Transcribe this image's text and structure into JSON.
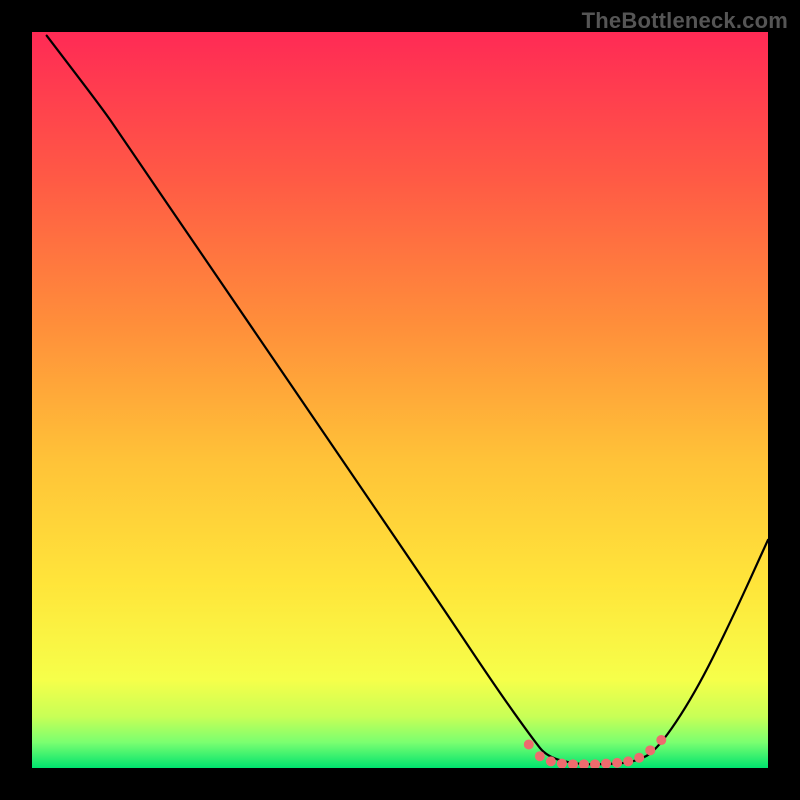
{
  "watermark": "TheBottleneck.com",
  "chart_data": {
    "type": "line",
    "title": "",
    "xlabel": "",
    "ylabel": "",
    "xlim": [
      0,
      100
    ],
    "ylim": [
      0,
      100
    ],
    "grid": false,
    "legend": false,
    "background_gradient": {
      "stops": [
        {
          "offset": 0.0,
          "color": "#ff2a55"
        },
        {
          "offset": 0.2,
          "color": "#ff5a45"
        },
        {
          "offset": 0.4,
          "color": "#ff8f3a"
        },
        {
          "offset": 0.58,
          "color": "#ffc238"
        },
        {
          "offset": 0.75,
          "color": "#ffe53a"
        },
        {
          "offset": 0.88,
          "color": "#f6ff4a"
        },
        {
          "offset": 0.93,
          "color": "#c8ff56"
        },
        {
          "offset": 0.965,
          "color": "#7bff70"
        },
        {
          "offset": 1.0,
          "color": "#00e36e"
        }
      ]
    },
    "series": [
      {
        "name": "bottleneck-curve",
        "stroke": "#000000",
        "stroke_width": 2.2,
        "points": [
          {
            "x": 2.0,
            "y": 99.5
          },
          {
            "x": 10.0,
            "y": 89.0
          },
          {
            "x": 12.0,
            "y": 86.0
          },
          {
            "x": 25.0,
            "y": 67.0
          },
          {
            "x": 40.0,
            "y": 45.0
          },
          {
            "x": 55.0,
            "y": 23.0
          },
          {
            "x": 63.0,
            "y": 11.0
          },
          {
            "x": 68.0,
            "y": 4.0
          },
          {
            "x": 70.0,
            "y": 1.5
          },
          {
            "x": 74.0,
            "y": 0.5
          },
          {
            "x": 78.0,
            "y": 0.5
          },
          {
            "x": 82.0,
            "y": 0.8
          },
          {
            "x": 85.0,
            "y": 2.5
          },
          {
            "x": 90.0,
            "y": 10.0
          },
          {
            "x": 95.0,
            "y": 20.0
          },
          {
            "x": 100.0,
            "y": 31.0
          }
        ]
      },
      {
        "name": "bottom-dots",
        "stroke": "#ee6b6e",
        "marker_radius": 5,
        "points": [
          {
            "x": 67.5,
            "y": 3.2
          },
          {
            "x": 69.0,
            "y": 1.6
          },
          {
            "x": 70.5,
            "y": 0.9
          },
          {
            "x": 72.0,
            "y": 0.6
          },
          {
            "x": 73.5,
            "y": 0.5
          },
          {
            "x": 75.0,
            "y": 0.5
          },
          {
            "x": 76.5,
            "y": 0.5
          },
          {
            "x": 78.0,
            "y": 0.6
          },
          {
            "x": 79.5,
            "y": 0.7
          },
          {
            "x": 81.0,
            "y": 0.9
          },
          {
            "x": 82.5,
            "y": 1.4
          },
          {
            "x": 84.0,
            "y": 2.4
          },
          {
            "x": 85.5,
            "y": 3.8
          }
        ]
      }
    ]
  }
}
